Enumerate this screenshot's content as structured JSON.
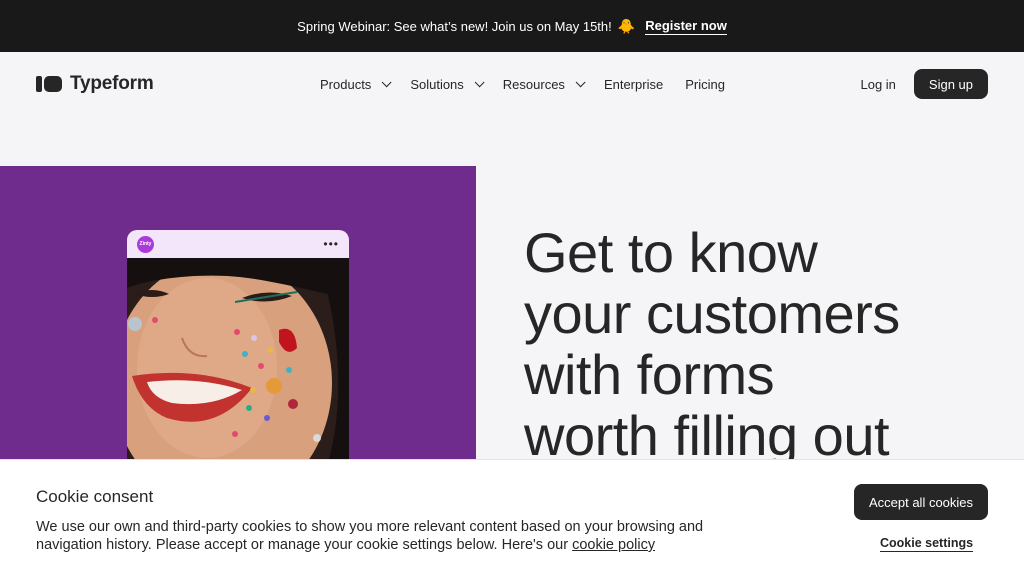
{
  "announcement": {
    "text": "Spring Webinar: See what’s new! Join us on May 15th!",
    "emoji": "🐥",
    "link_label": "Register now"
  },
  "header": {
    "logo_text": "Typeform",
    "nav": [
      {
        "label": "Products",
        "has_dropdown": true
      },
      {
        "label": "Solutions",
        "has_dropdown": true
      },
      {
        "label": "Resources",
        "has_dropdown": true
      },
      {
        "label": "Enterprise",
        "has_dropdown": false
      },
      {
        "label": "Pricing",
        "has_dropdown": false
      }
    ],
    "login_label": "Log in",
    "signup_label": "Sign up"
  },
  "hero": {
    "panel_color": "#6f2c8c",
    "card_avatar_text": "Zinty",
    "card_menu": "•••",
    "headline_lines": [
      "Get to know",
      "your customers",
      "with forms",
      "worth filling out"
    ]
  },
  "cookie": {
    "title": "Cookie consent",
    "body": "We use our own and third-party cookies to show you more relevant content based on your browsing and navigation history. Please accept or manage your cookie settings below. Here's our",
    "policy_link": "cookie policy",
    "accept_label": "Accept all cookies",
    "settings_label": "Cookie settings"
  },
  "colors": {
    "dark": "#262627",
    "announce_bg": "#191919",
    "page_bg": "#f5f5f7",
    "hero_purple": "#6f2c8c",
    "card_bg": "#f3e6fb"
  }
}
